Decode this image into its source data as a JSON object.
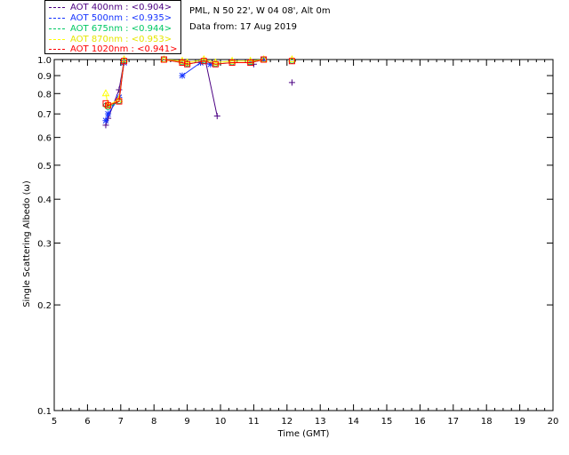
{
  "header": {
    "location": "PML, N 50 22', W 04 08', Alt 0m",
    "date": "Data from: 17 Aug 2019"
  },
  "legend": [
    {
      "text": "AOT  400nm : <0.904>",
      "color": "#4b0082"
    },
    {
      "text": "AOT  500nm : <0.935>",
      "color": "#1432ff"
    },
    {
      "text": "AOT  675nm : <0.944>",
      "color": "#00c864"
    },
    {
      "text": "AOT  870nm : <0.953>",
      "color": "#ffff00"
    },
    {
      "text": "AOT 1020nm : <0.941>",
      "color": "#ff0000"
    }
  ],
  "chart_data": {
    "type": "scatter",
    "xlabel": "Time (GMT)",
    "ylabel": "Single Scattering Albedo (ω)",
    "xlim": [
      5,
      20
    ],
    "ylim": [
      0.1,
      1.0
    ],
    "yscale": "log",
    "xticks": [
      "5",
      "6",
      "7",
      "8",
      "9",
      "10",
      "11",
      "12",
      "13",
      "14",
      "15",
      "16",
      "17",
      "18",
      "19",
      "20"
    ],
    "yticks": [
      {
        "v": 1.0,
        "label": "1.0"
      },
      {
        "v": 0.9,
        "label": "0.9"
      },
      {
        "v": 0.8,
        "label": "0.8"
      },
      {
        "v": 0.7,
        "label": "0.7"
      },
      {
        "v": 0.6,
        "label": "0.6"
      },
      {
        "v": 0.5,
        "label": "0.5"
      },
      {
        "v": 0.4,
        "label": "0.4"
      },
      {
        "v": 0.3,
        "label": "0.3"
      },
      {
        "v": 0.2,
        "label": "0.2"
      },
      {
        "v": 0.1,
        "label": "0.1"
      }
    ],
    "series": [
      {
        "name": "AOT  400nm",
        "color": "#4b0082",
        "marker": "plus",
        "x": [
          6.55,
          6.62,
          6.95,
          7.1,
          8.85,
          9.55,
          9.9,
          11.0,
          12.15
        ],
        "y": [
          0.65,
          0.68,
          0.82,
          0.99,
          0.99,
          0.99,
          0.69,
          0.97,
          0.86
        ]
      },
      {
        "name": "AOT  500nm",
        "color": "#1432ff",
        "marker": "asterisk",
        "x": [
          6.55,
          6.62,
          6.95,
          7.1,
          8.85,
          9.4,
          9.7,
          10.9,
          11.3
        ],
        "y": [
          0.67,
          0.7,
          0.78,
          0.98,
          0.9,
          0.98,
          0.97,
          0.98,
          1.0
        ]
      },
      {
        "name": "AOT  675nm",
        "color": "#00c864",
        "marker": "circle",
        "x": [
          6.55,
          6.62,
          6.95,
          7.1,
          8.3,
          8.85,
          9.0,
          9.5,
          9.85,
          10.35,
          10.9,
          11.3,
          12.15
        ],
        "y": [
          0.74,
          0.73,
          0.76,
          0.99,
          1.0,
          0.98,
          0.97,
          0.99,
          0.97,
          0.98,
          0.98,
          1.0,
          0.99
        ]
      },
      {
        "name": "AOT  870nm",
        "color": "#ffff00",
        "marker": "triangle",
        "x": [
          6.55,
          6.62,
          6.95,
          7.1,
          8.3,
          8.85,
          9.0,
          9.5,
          9.85,
          10.35,
          10.9,
          11.3,
          12.15
        ],
        "y": [
          0.8,
          0.74,
          0.77,
          1.0,
          1.0,
          0.99,
          0.98,
          1.0,
          0.98,
          0.99,
          0.99,
          1.0,
          1.0
        ]
      },
      {
        "name": "AOT 1020nm",
        "color": "#ff0000",
        "marker": "square",
        "x": [
          6.55,
          6.62,
          6.95,
          7.1,
          8.3,
          8.85,
          9.0,
          9.5,
          9.85,
          10.35,
          10.9,
          11.3,
          12.15
        ],
        "y": [
          0.75,
          0.74,
          0.76,
          0.99,
          1.0,
          0.98,
          0.97,
          0.99,
          0.97,
          0.98,
          0.98,
          1.0,
          0.99
        ]
      }
    ]
  }
}
